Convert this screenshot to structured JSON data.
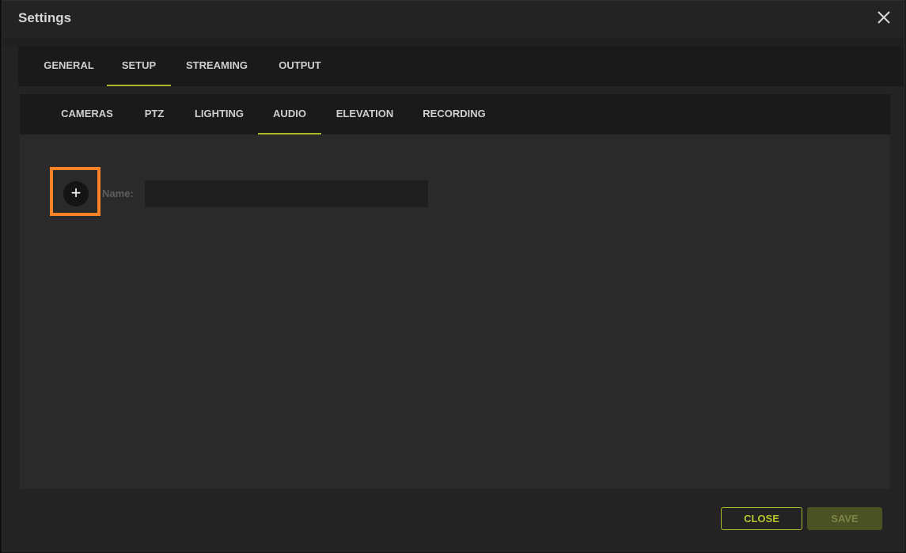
{
  "dialog": {
    "title": "Settings"
  },
  "main_tabs": [
    {
      "label": "GENERAL",
      "active": false
    },
    {
      "label": "SETUP",
      "active": true
    },
    {
      "label": "STREAMING",
      "active": false
    },
    {
      "label": "OUTPUT",
      "active": false
    }
  ],
  "sub_tabs": [
    {
      "label": "CAMERAS",
      "active": false
    },
    {
      "label": "PTZ",
      "active": false
    },
    {
      "label": "LIGHTING",
      "active": false
    },
    {
      "label": "AUDIO",
      "active": true
    },
    {
      "label": "ELEVATION",
      "active": false
    },
    {
      "label": "RECORDING",
      "active": false
    }
  ],
  "audio_form": {
    "add_symbol": "+",
    "name_label": "Name:",
    "name_value": "",
    "name_placeholder": ""
  },
  "footer": {
    "close_label": "CLOSE",
    "save_label": "SAVE"
  },
  "icons": {
    "close": "close-icon",
    "add": "plus-icon"
  },
  "colors": {
    "accent": "#a8b829",
    "highlight": "#ff8125"
  }
}
